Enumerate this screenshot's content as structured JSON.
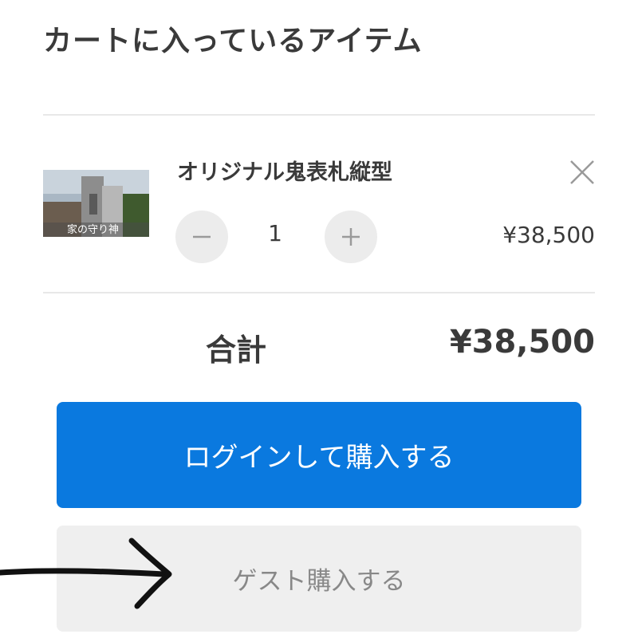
{
  "header": {
    "title": "カートに入っているアイテム"
  },
  "cart": {
    "item": {
      "name": "オリジナル鬼表札縦型",
      "thumbnail_caption": "家の守り神",
      "quantity": "1",
      "price": "¥38,500",
      "icons": {
        "remove": "close-icon",
        "decrement": "minus-icon",
        "increment": "plus-icon"
      }
    },
    "total_label": "合計",
    "total_value": "¥38,500"
  },
  "actions": {
    "login_purchase": "ログインして購入する",
    "guest_purchase": "ゲスト購入する"
  },
  "annotation": {
    "icon": "arrow-right-icon"
  },
  "colors": {
    "primary": "#0a79df",
    "guest_bg": "#efefef",
    "stepper_bg": "#ececec",
    "text": "#3a3a3a"
  }
}
